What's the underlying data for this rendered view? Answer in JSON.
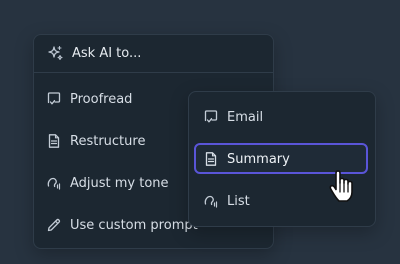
{
  "menu": {
    "ask_label": "Ask AI to...",
    "items": [
      {
        "label": "Proofread",
        "icon": "proofread-icon"
      },
      {
        "label": "Restructure",
        "icon": "document-icon"
      },
      {
        "label": "Adjust my tone",
        "icon": "voice-icon"
      },
      {
        "label": "Use custom prompt",
        "icon": "pencil-icon"
      }
    ]
  },
  "submenu": {
    "items": [
      {
        "label": "Email",
        "icon": "proofread-icon"
      },
      {
        "label": "Summary",
        "icon": "document-icon",
        "selected": true
      },
      {
        "label": "List",
        "icon": "voice-icon"
      }
    ]
  },
  "colors": {
    "background": "#273340",
    "panel": "#1c2731",
    "border": "#2f3c49",
    "accent": "#5a55d8",
    "text": "#d7dee6"
  },
  "cursor": "hand-pointer-icon"
}
